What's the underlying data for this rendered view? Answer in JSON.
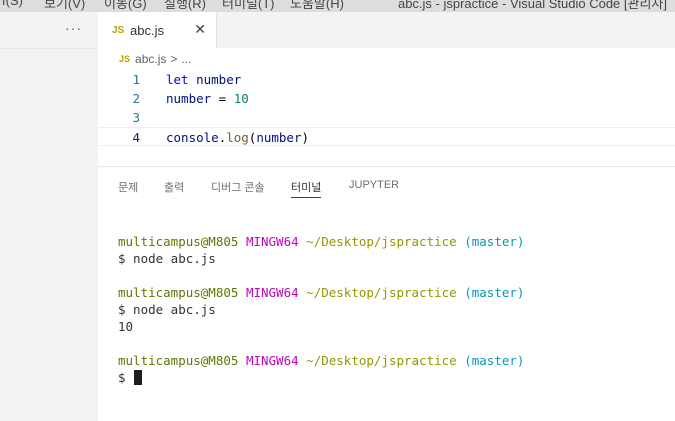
{
  "titlebar": {
    "menu": [
      "f(S)",
      "보기(V)",
      "이동(G)",
      "실행(R)",
      "터미널(T)",
      "도움말(H)"
    ],
    "window_title": "abc.js - jspractice - Visual Studio Code [관리자]"
  },
  "sidebar": {
    "more_icon": "ellipsis-icon",
    "more_label": "···"
  },
  "tab": {
    "icon_label": "JS",
    "label": "abc.js",
    "close_label": "✕"
  },
  "breadcrumb": {
    "icon_label": "JS",
    "file": "abc.js",
    "separator": ">",
    "more": "..."
  },
  "editor": {
    "lines": [
      {
        "num": "1",
        "tokens": [
          {
            "t": "let",
            "c": "kw"
          },
          {
            "t": " ",
            "c": ""
          },
          {
            "t": "number",
            "c": "var"
          }
        ]
      },
      {
        "num": "2",
        "tokens": [
          {
            "t": "number",
            "c": "var"
          },
          {
            "t": " = ",
            "c": ""
          },
          {
            "t": "10",
            "c": "num"
          }
        ]
      },
      {
        "num": "3",
        "tokens": []
      },
      {
        "num": "4",
        "tokens": [
          {
            "t": "console",
            "c": "var"
          },
          {
            "t": ".",
            "c": ""
          },
          {
            "t": "log",
            "c": "fn"
          },
          {
            "t": "(",
            "c": ""
          },
          {
            "t": "number",
            "c": "var"
          },
          {
            "t": ")",
            "c": ""
          }
        ]
      }
    ]
  },
  "panel": {
    "tabs": [
      "문제",
      "출력",
      "디버그 콘솔",
      "터미널",
      "JUPYTER"
    ],
    "active_tab": "터미널"
  },
  "terminal": {
    "prompt_user": "multicampus@M805",
    "prompt_host": "MINGW64",
    "prompt_path": "~/Desktop/jspractice",
    "prompt_branch": "(master)",
    "command1": "$ node abc.js",
    "command2": "$ node abc.js",
    "output2": "10",
    "current_prompt": "$"
  }
}
